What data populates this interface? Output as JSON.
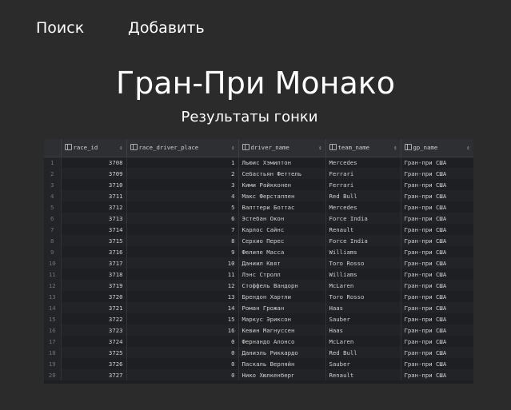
{
  "nav": {
    "search_label": "Поиск",
    "add_label": "Добавить"
  },
  "header": {
    "title": "Гран-При Монако",
    "subtitle": "Результаты гонки"
  },
  "results_table": {
    "columns": [
      "race_id",
      "race_driver_place",
      "driver_name",
      "team_name",
      "gp_name"
    ],
    "rows": [
      {
        "n": "1",
        "race_id": "3708",
        "place": "1",
        "driver": "Льюис Хэмилтон",
        "team": "Mercedes",
        "gp": "Гран-при США"
      },
      {
        "n": "2",
        "race_id": "3709",
        "place": "2",
        "driver": "Себастьян Феттель",
        "team": "Ferrari",
        "gp": "Гран-при США"
      },
      {
        "n": "3",
        "race_id": "3710",
        "place": "3",
        "driver": "Кими Райкконен",
        "team": "Ferrari",
        "gp": "Гран-при США"
      },
      {
        "n": "4",
        "race_id": "3711",
        "place": "4",
        "driver": "Макс Ферстаппен",
        "team": "Red Bull",
        "gp": "Гран-при США"
      },
      {
        "n": "5",
        "race_id": "3712",
        "place": "5",
        "driver": "Валттери Боттас",
        "team": "Mercedes",
        "gp": "Гран-при США"
      },
      {
        "n": "6",
        "race_id": "3713",
        "place": "6",
        "driver": "Эстебан Окон",
        "team": "Force India",
        "gp": "Гран-при США"
      },
      {
        "n": "7",
        "race_id": "3714",
        "place": "7",
        "driver": "Карлос Сайнс",
        "team": "Renault",
        "gp": "Гран-при США"
      },
      {
        "n": "8",
        "race_id": "3715",
        "place": "8",
        "driver": "Серхио Перес",
        "team": "Force India",
        "gp": "Гран-при США"
      },
      {
        "n": "9",
        "race_id": "3716",
        "place": "9",
        "driver": "Фелипе Масса",
        "team": "Williams",
        "gp": "Гран-при США"
      },
      {
        "n": "10",
        "race_id": "3717",
        "place": "10",
        "driver": "Даниил Квят",
        "team": "Toro Rosso",
        "gp": "Гран-при США"
      },
      {
        "n": "11",
        "race_id": "3718",
        "place": "11",
        "driver": "Лэнс Стролл",
        "team": "Williams",
        "gp": "Гран-при США"
      },
      {
        "n": "12",
        "race_id": "3719",
        "place": "12",
        "driver": "Стоффель Вандорн",
        "team": "McLaren",
        "gp": "Гран-при США"
      },
      {
        "n": "13",
        "race_id": "3720",
        "place": "13",
        "driver": "Брендон Хартли",
        "team": "Toro Rosso",
        "gp": "Гран-при США"
      },
      {
        "n": "14",
        "race_id": "3721",
        "place": "14",
        "driver": "Роман Грожан",
        "team": "Haas",
        "gp": "Гран-при США"
      },
      {
        "n": "15",
        "race_id": "3722",
        "place": "15",
        "driver": "Маркус Эриксон",
        "team": "Sauber",
        "gp": "Гран-при США"
      },
      {
        "n": "16",
        "race_id": "3723",
        "place": "16",
        "driver": "Кевин Магнуссен",
        "team": "Haas",
        "gp": "Гран-при США"
      },
      {
        "n": "17",
        "race_id": "3724",
        "place": "0",
        "driver": "Фернандо Алонсо",
        "team": "McLaren",
        "gp": "Гран-при США"
      },
      {
        "n": "18",
        "race_id": "3725",
        "place": "0",
        "driver": "Даниэль Риккардо",
        "team": "Red Bull",
        "gp": "Гран-при США"
      },
      {
        "n": "19",
        "race_id": "3726",
        "place": "0",
        "driver": "Паскаль Верляйн",
        "team": "Sauber",
        "gp": "Гран-при США"
      },
      {
        "n": "20",
        "race_id": "3727",
        "place": "0",
        "driver": "Нико Хюлкенберг",
        "team": "Renault",
        "gp": "Гран-при США"
      }
    ]
  }
}
